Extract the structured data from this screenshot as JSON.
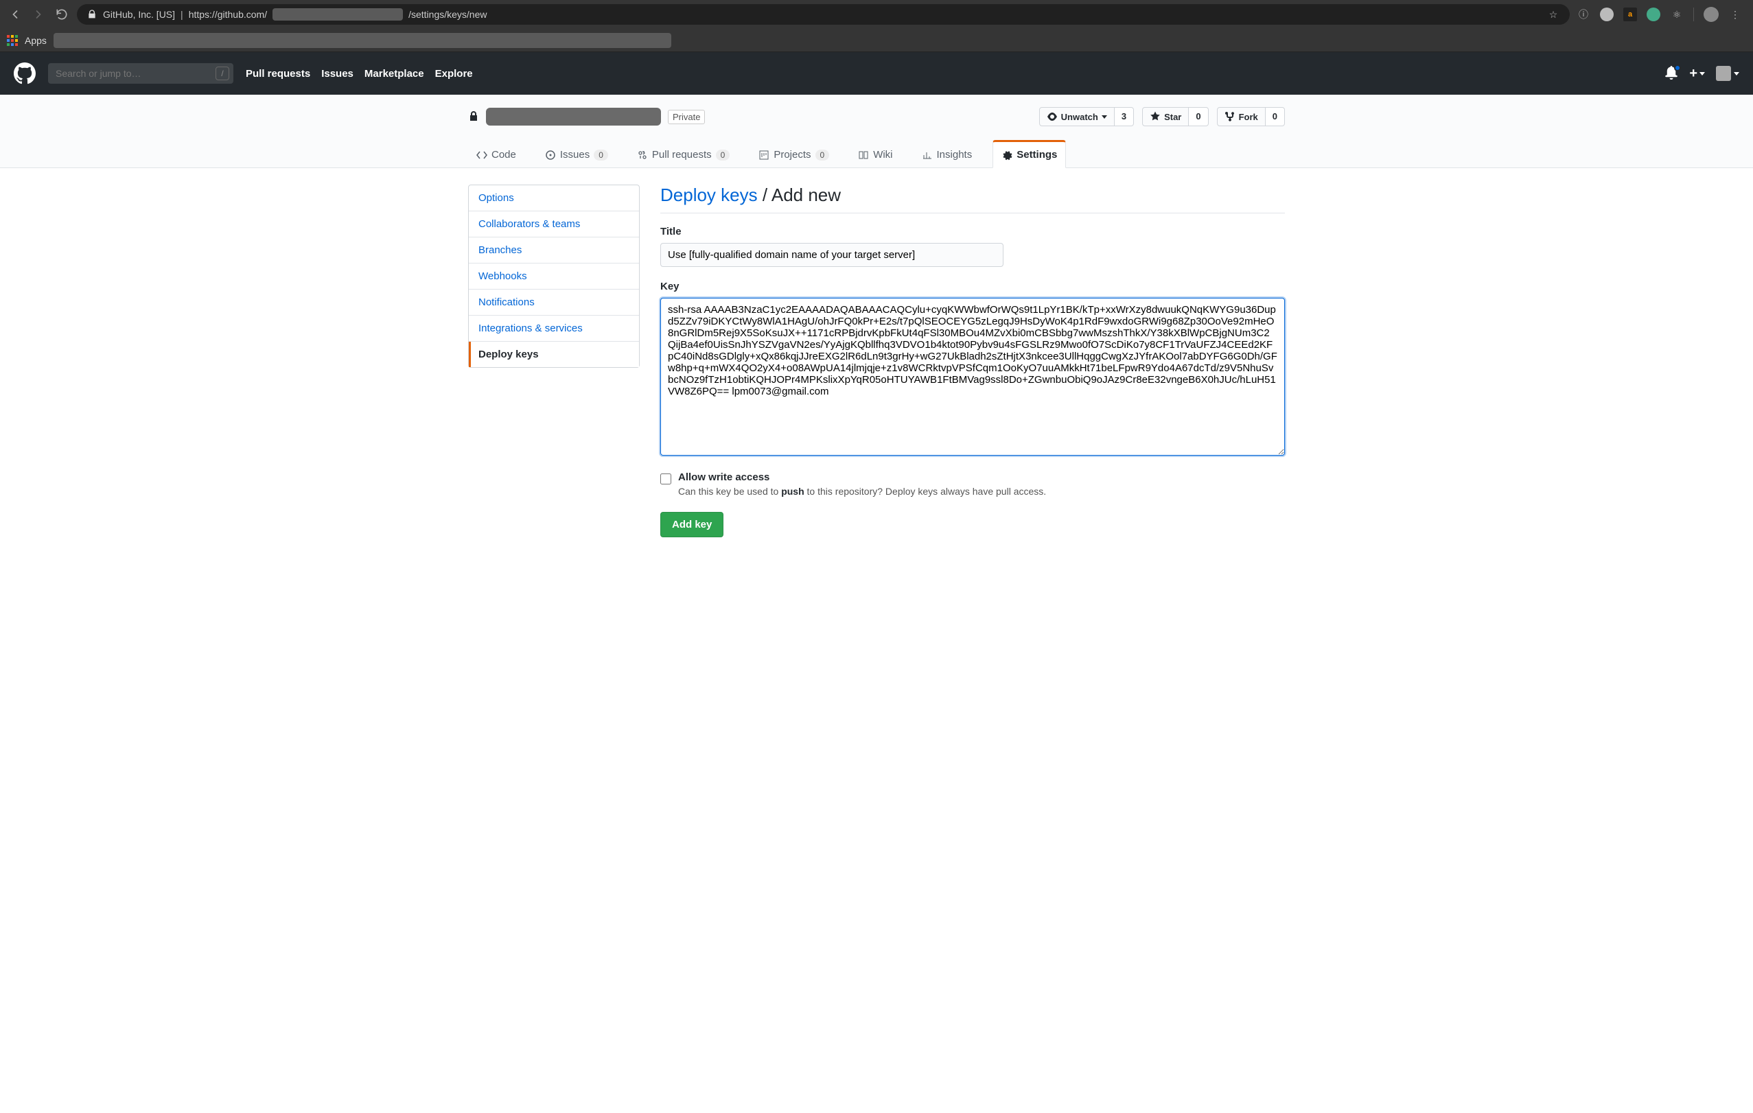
{
  "browser": {
    "org": "GitHub, Inc. [US]",
    "url_prefix": "https://github.com/",
    "url_suffix": "/settings/keys/new",
    "bookmarks": {
      "apps_label": "Apps"
    }
  },
  "gh_header": {
    "search_placeholder": "Search or jump to…",
    "slash": "/",
    "nav": {
      "pull_requests": "Pull requests",
      "issues": "Issues",
      "marketplace": "Marketplace",
      "explore": "Explore"
    }
  },
  "repo": {
    "private_badge": "Private",
    "actions": {
      "unwatch": {
        "label": "Unwatch",
        "count": "3"
      },
      "star": {
        "label": "Star",
        "count": "0"
      },
      "fork": {
        "label": "Fork",
        "count": "0"
      }
    },
    "tabs": {
      "code": "Code",
      "issues": {
        "label": "Issues",
        "count": "0"
      },
      "pull_requests": {
        "label": "Pull requests",
        "count": "0"
      },
      "projects": {
        "label": "Projects",
        "count": "0"
      },
      "wiki": "Wiki",
      "insights": "Insights",
      "settings": "Settings"
    }
  },
  "sidebar": {
    "items": [
      "Options",
      "Collaborators & teams",
      "Branches",
      "Webhooks",
      "Notifications",
      "Integrations & services",
      "Deploy keys"
    ]
  },
  "page": {
    "heading_link": "Deploy keys",
    "heading_rest": " / Add new",
    "title_label": "Title",
    "title_value": "Use [fully-qualified domain name of your target server]",
    "key_label": "Key",
    "key_value": "ssh-rsa AAAAB3NzaC1yc2EAAAADAQABAAACAQCylu+cyqKWWbwfOrWQs9t1LpYr1BK/kTp+xxWrXzy8dwuukQNqKWYG9u36Dupd5ZZv79iDKYCtWy8WlA1HAgU/ohJrFQ0kPr+E2s/t7pQlSEOCEYG5zLegqJ9HsDyWoK4p1RdF9wxdoGRWi9g68Zp30OoVe92mHeO8nGRlDm5Rej9X5SoKsuJX++1171cRPBjdrvKpbFkUt4qFSl30MBOu4MZvXbi0mCBSbbg7wwMszshThkX/Y38kXBlWpCBjgNUm3C2QijBa4ef0UisSnJhYSZVgaVN2es/YyAjgKQbllfhq3VDVO1b4ktot90Pybv9u4sFGSLRz9Mwo0fO7ScDiKo7y8CF1TrVaUFZJ4CEEd2KFpC40iNd8sGDlgly+xQx86kqjJJreEXG2lR6dLn9t3grHy+wG27UkBladh2sZtHjtX3nkcee3UllHqggCwgXzJYfrAKOol7abDYFG6G0Dh/GFw8hp+q+mWX4QO2yX4+o08AWpUA14jlmjqje+z1v8WCRktvpVPSfCqm1OoKyO7uuAMkkHt71beLFpwR9Ydo4A67dcTd/z9V5NhuSvbcNOz9fTzH1obtiKQHJOPr4MPKslixXpYqR05oHTUYAWB1FtBMVag9ssl8Do+ZGwnbuObiQ9oJAz9Cr8eE32vngeB6X0hJUc/hLuH51VW8Z6PQ== lpm0073@gmail.com",
    "allow_write_label": "Allow write access",
    "allow_write_hint_pre": "Can this key be used to ",
    "allow_write_hint_strong": "push",
    "allow_write_hint_post": " to this repository? Deploy keys always have pull access.",
    "submit": "Add key"
  }
}
